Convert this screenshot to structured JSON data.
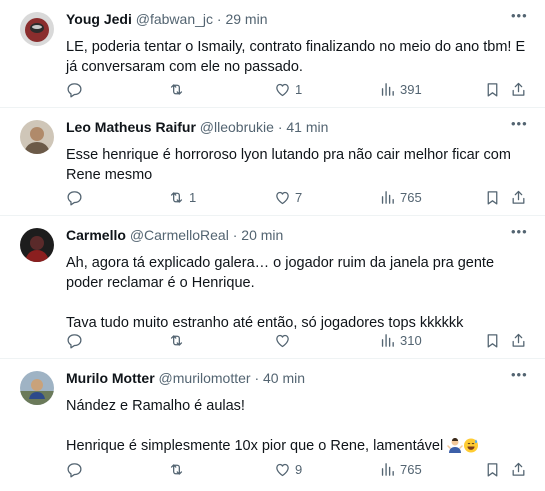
{
  "tweets": [
    {
      "name": "Youg Jedi",
      "handle": "@fabwan_jc",
      "sep": "·",
      "time": "29 min",
      "paragraphs": [
        "LE, poderia tentar o Ismaily, contrato finalizando no meio do ano tbm! E já conversaram com ele no passado."
      ],
      "replies": "",
      "retweets": "",
      "likes": "1",
      "views": "391",
      "avatar_color": "#8a2d2d"
    },
    {
      "name": "Leo Matheus Raifur",
      "handle": "@lleobrukie",
      "sep": "·",
      "time": "41 min",
      "paragraphs": [
        "Esse henrique é horroroso lyon lutando pra não cair melhor ficar com Rene mesmo"
      ],
      "replies": "",
      "retweets": "1",
      "likes": "7",
      "views": "765",
      "avatar_color": "#b08a6a"
    },
    {
      "name": "Carmello",
      "handle": "@CarmelloReal",
      "sep": "·",
      "time": "20 min",
      "paragraphs": [
        "Ah, agora tá explicado galera… o jogador ruim da janela pra gente poder reclamar é o Henrique.",
        "Tava tudo muito estranho até então, só jogadores tops kkkkkk"
      ],
      "replies": "",
      "retweets": "",
      "likes": "",
      "views": "310",
      "avatar_color": "#3a1a1a"
    },
    {
      "name": "Murilo Motter",
      "handle": "@murilomotter",
      "sep": "·",
      "time": "40 min",
      "paragraphs": [
        "Nández e Ramalho é aulas!",
        "Henrique é simplesmente 10x pior que o Rene, lamentável"
      ],
      "replies": "",
      "retweets": "",
      "likes": "9",
      "views": "765",
      "avatar_color": "#7a8a9a"
    }
  ],
  "icons": {
    "more": "more-horizontal-icon",
    "reply": "reply-icon",
    "retweet": "retweet-icon",
    "like": "heart-icon",
    "views": "views-chart-icon",
    "bookmark": "bookmark-icon",
    "share": "share-icon"
  },
  "colors": {
    "text": "#0f1419",
    "secondary": "#536471",
    "divider": "#eff3f4"
  }
}
